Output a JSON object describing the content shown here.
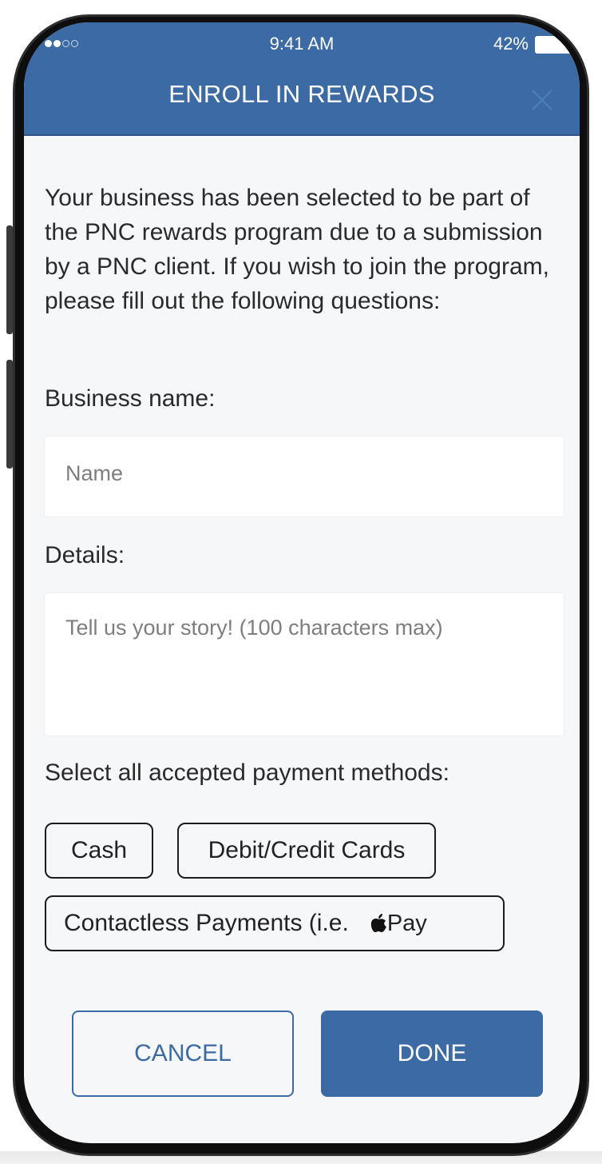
{
  "status_bar": {
    "time": "9:41 AM",
    "battery_percent": "42%"
  },
  "header": {
    "title": "ENROLL IN REWARDS"
  },
  "intro_text": "Your business has been selected to be part of the PNC rewards program due to a submission by a PNC client. If you wish to join the program, please fill out the following questions:",
  "business_name": {
    "label": "Business name:",
    "placeholder": "Name"
  },
  "details": {
    "label": "Details:",
    "placeholder": "Tell us your story! (100 characters max)"
  },
  "payment": {
    "label": "Select all accepted payment methods:",
    "options": {
      "cash": "Cash",
      "cards": "Debit/Credit Cards",
      "contactless": "Contactless Payments (i.e.",
      "apple_pay_text": "Pay"
    }
  },
  "actions": {
    "cancel": "CANCEL",
    "done": "DONE"
  },
  "colors": {
    "brand_blue": "#3b6aa4",
    "background": "#f6f7f9"
  }
}
